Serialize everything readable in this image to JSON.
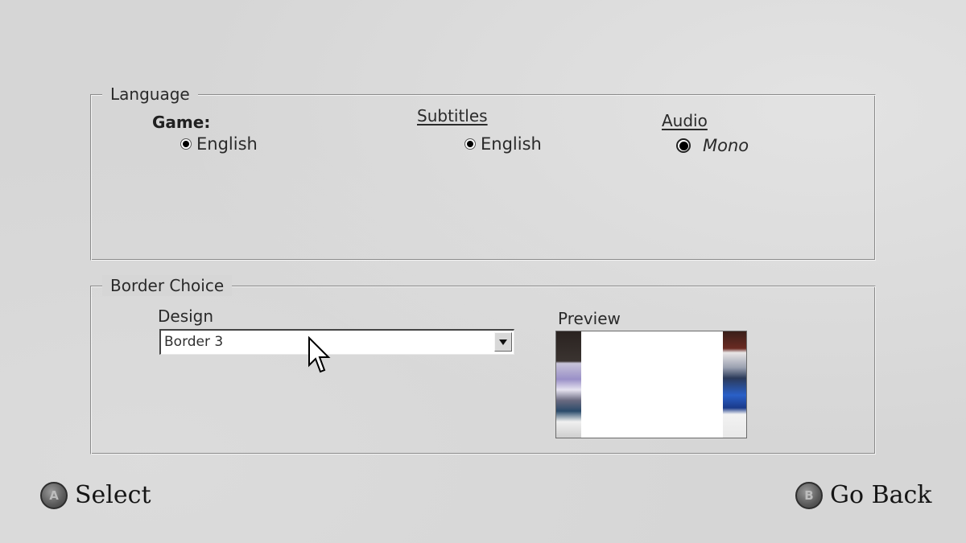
{
  "language_panel": {
    "legend": "Language",
    "game": {
      "label": "Game:",
      "selected_option": "English"
    },
    "subtitles": {
      "label": "Subtitles",
      "selected_option": "English"
    },
    "audio": {
      "label": "Audio",
      "selected_option": "Mono"
    }
  },
  "border_panel": {
    "legend": "Border Choice",
    "design": {
      "label": "Design",
      "selected_value": "Border 3"
    },
    "preview": {
      "label": "Preview"
    }
  },
  "footer": {
    "select": {
      "button_glyph": "A",
      "label": "Select"
    },
    "back": {
      "button_glyph": "B",
      "label": "Go Back"
    }
  }
}
